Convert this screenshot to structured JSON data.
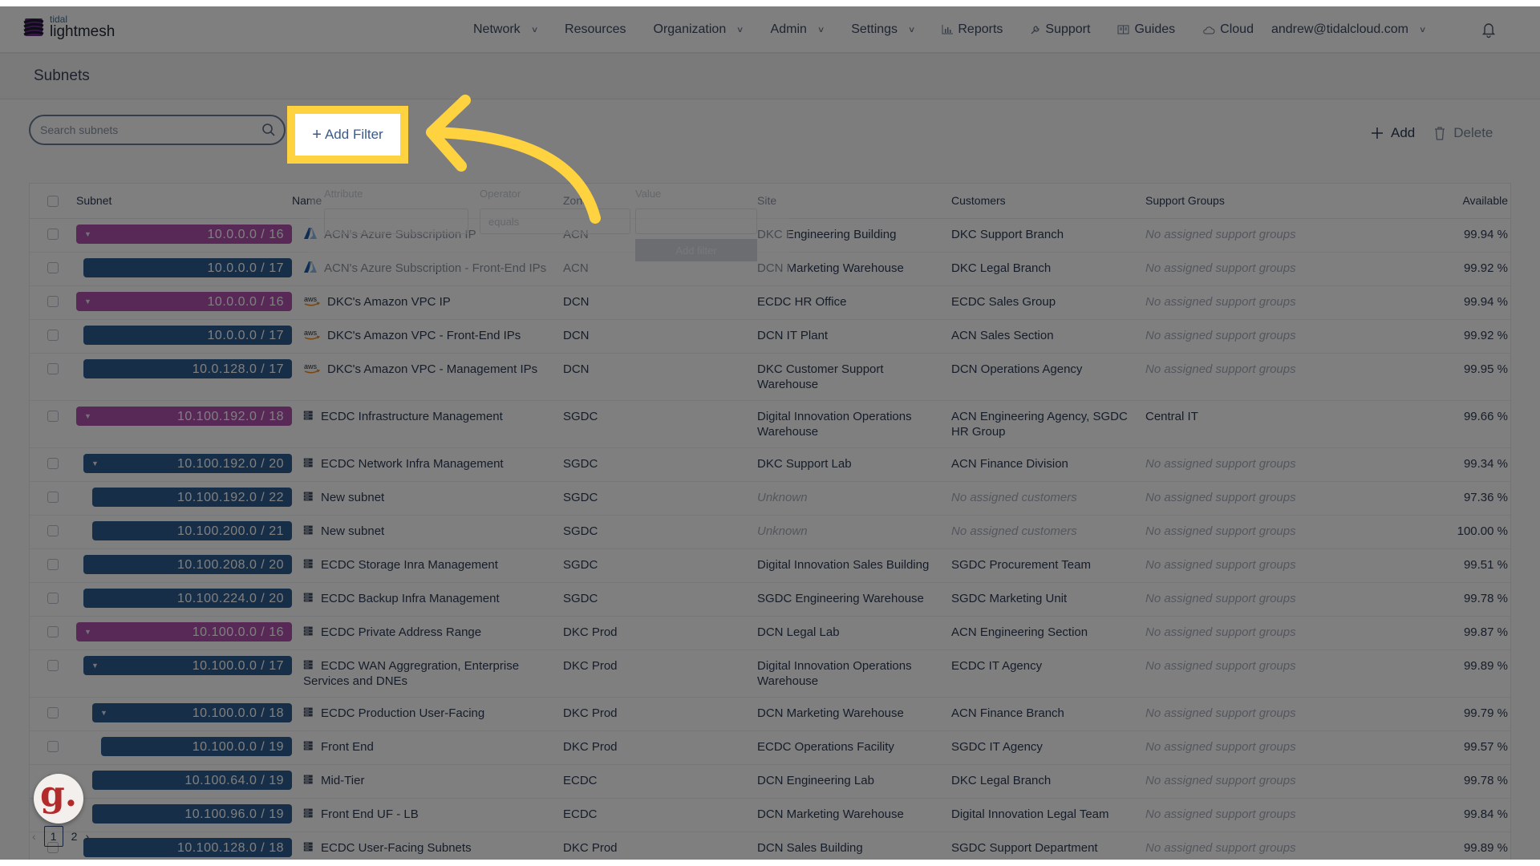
{
  "app": {
    "logo_small": "tidal",
    "logo_big": "lightmesh"
  },
  "nav": {
    "items": [
      {
        "label": "Network",
        "icon": "",
        "dropdown": true
      },
      {
        "label": "Resources",
        "icon": "",
        "dropdown": false
      },
      {
        "label": "Organization",
        "icon": "",
        "dropdown": true
      },
      {
        "label": "Admin",
        "icon": "",
        "dropdown": true
      },
      {
        "label": "Settings",
        "icon": "",
        "dropdown": true
      },
      {
        "label": "Reports",
        "icon": "bar-chart-icon",
        "dropdown": false
      },
      {
        "label": "Support",
        "icon": "wrench-icon",
        "dropdown": false
      },
      {
        "label": "Guides",
        "icon": "book-icon",
        "dropdown": false
      },
      {
        "label": "Cloud",
        "icon": "cloud-icon",
        "dropdown": false
      }
    ],
    "user": "andrew@tidalcloud.com"
  },
  "page": {
    "title": "Subnets"
  },
  "toolbar": {
    "search_placeholder": "Search subnets",
    "search_value": "",
    "add_filter_label": "Add Filter",
    "add_label": "Add",
    "delete_label": "Delete"
  },
  "filter_popover": {
    "attribute_label": "Attribute",
    "operator_label": "Operator",
    "operator_value": "equals",
    "value_label": "Value",
    "submit_label": "Add filter"
  },
  "table": {
    "columns": [
      "Subnet",
      "Name",
      "Zone",
      "Site",
      "Customers",
      "Support Groups",
      "Available"
    ],
    "rows": [
      {
        "subnet": "10.0.0.0 / 16",
        "level": 0,
        "expandable": true,
        "color": "purple",
        "icon": "azure",
        "name": "ACN's Azure Subscription IP",
        "zone": "ACN",
        "site": "DKC Engineering Building",
        "customers": "DKC Support Branch",
        "support_groups": "No assigned support groups",
        "available": "99.94 %"
      },
      {
        "subnet": "10.0.0.0 / 17",
        "level": 1,
        "expandable": false,
        "color": "blue",
        "icon": "azure",
        "name": "ACN's Azure Subscription - Front-End IPs",
        "zone": "ACN",
        "site": "DCN Marketing Warehouse",
        "customers": "DKC Legal Branch",
        "support_groups": "No assigned support groups",
        "available": "99.92 %"
      },
      {
        "subnet": "10.0.0.0 / 16",
        "level": 0,
        "expandable": true,
        "color": "purple",
        "icon": "aws",
        "name": "DKC's Amazon VPC IP",
        "zone": "DCN",
        "site": "ECDC HR Office",
        "customers": "ECDC Sales Group",
        "support_groups": "No assigned support groups",
        "available": "99.94 %"
      },
      {
        "subnet": "10.0.0.0 / 17",
        "level": 1,
        "expandable": false,
        "color": "blue",
        "icon": "aws",
        "name": "DKC's Amazon VPC - Front-End IPs",
        "zone": "DCN",
        "site": "DCN IT Plant",
        "customers": "ACN Sales Section",
        "support_groups": "No assigned support groups",
        "available": "99.92 %"
      },
      {
        "subnet": "10.0.128.0 / 17",
        "level": 1,
        "expandable": false,
        "color": "blue",
        "icon": "aws",
        "name": "DKC's Amazon VPC - Management IPs",
        "zone": "DCN",
        "site": "DKC Customer Support Warehouse",
        "customers": "DCN Operations Agency",
        "support_groups": "No assigned support groups",
        "available": "99.95 %"
      },
      {
        "subnet": "10.100.192.0 / 18",
        "level": 0,
        "expandable": true,
        "color": "purple",
        "icon": "server",
        "name": "ECDC Infrastructure Management",
        "zone": "SGDC",
        "site": "Digital Innovation Operations Warehouse",
        "customers": "ACN Engineering Agency, SGDC HR Group",
        "support_groups": "Central IT",
        "available": "99.66 %"
      },
      {
        "subnet": "10.100.192.0 / 20",
        "level": 1,
        "expandable": true,
        "color": "blue",
        "icon": "server",
        "name": "ECDC Network Infra Management",
        "zone": "SGDC",
        "site": "DKC Support Lab",
        "customers": "ACN Finance Division",
        "support_groups": "No assigned support groups",
        "available": "99.34 %"
      },
      {
        "subnet": "10.100.192.0 / 22",
        "level": 2,
        "expandable": false,
        "color": "blue",
        "icon": "server",
        "name": "New subnet",
        "zone": "SGDC",
        "site": "Unknown",
        "customers": "No assigned customers",
        "support_groups": "No assigned support groups",
        "available": "97.36 %"
      },
      {
        "subnet": "10.100.200.0 / 21",
        "level": 2,
        "expandable": false,
        "color": "blue",
        "icon": "server",
        "name": "New subnet",
        "zone": "SGDC",
        "site": "Unknown",
        "customers": "No assigned customers",
        "support_groups": "No assigned support groups",
        "available": "100.00 %"
      },
      {
        "subnet": "10.100.208.0 / 20",
        "level": 1,
        "expandable": false,
        "color": "blue",
        "icon": "server",
        "name": "ECDC Storage Inra Management",
        "zone": "SGDC",
        "site": "Digital Innovation Sales Building",
        "customers": "SGDC Procurement Team",
        "support_groups": "No assigned support groups",
        "available": "99.51 %"
      },
      {
        "subnet": "10.100.224.0 / 20",
        "level": 1,
        "expandable": false,
        "color": "blue",
        "icon": "server",
        "name": "ECDC Backup Infra Management",
        "zone": "SGDC",
        "site": "SGDC Engineering Warehouse",
        "customers": "SGDC Marketing Unit",
        "support_groups": "No assigned support groups",
        "available": "99.78 %"
      },
      {
        "subnet": "10.100.0.0 / 16",
        "level": 0,
        "expandable": true,
        "color": "purple",
        "icon": "server",
        "name": "ECDC Private Address Range",
        "zone": "DKC Prod",
        "site": "DCN Legal Lab",
        "customers": "ACN Engineering Section",
        "support_groups": "No assigned support groups",
        "available": "99.87 %"
      },
      {
        "subnet": "10.100.0.0 / 17",
        "level": 1,
        "expandable": true,
        "color": "blue",
        "icon": "server",
        "name": "ECDC WAN Aggregration, Enterprise Services and DNEs",
        "zone": "DKC Prod",
        "site": "Digital Innovation Operations Warehouse",
        "customers": "ECDC IT Agency",
        "support_groups": "No assigned support groups",
        "available": "99.89 %"
      },
      {
        "subnet": "10.100.0.0 / 18",
        "level": 2,
        "expandable": true,
        "color": "blue",
        "icon": "server",
        "name": "ECDC Production User-Facing",
        "zone": "DKC Prod",
        "site": "DCN Marketing Warehouse",
        "customers": "ACN Finance Branch",
        "support_groups": "No assigned support groups",
        "available": "99.79 %"
      },
      {
        "subnet": "10.100.0.0 / 19",
        "level": 3,
        "expandable": false,
        "color": "blue",
        "icon": "server",
        "name": "Front End",
        "zone": "DKC Prod",
        "site": "ECDC Operations Facility",
        "customers": "SGDC IT Agency",
        "support_groups": "No assigned support groups",
        "available": "99.57 %"
      },
      {
        "subnet": "10.100.64.0 / 19",
        "level": 2,
        "expandable": false,
        "color": "blue",
        "icon": "server",
        "name": "Mid-Tier",
        "zone": "ECDC",
        "site": "DCN Engineering Lab",
        "customers": "DKC Legal Branch",
        "support_groups": "No assigned support groups",
        "available": "99.78 %"
      },
      {
        "subnet": "10.100.96.0 / 19",
        "level": 2,
        "expandable": false,
        "color": "blue",
        "icon": "server",
        "name": "Front End UF - LB",
        "zone": "ECDC",
        "site": "DCN Marketing Warehouse",
        "customers": "Digital Innovation Legal Team",
        "support_groups": "No assigned support groups",
        "available": "99.84 %"
      },
      {
        "subnet": "10.100.128.0 / 18",
        "level": 1,
        "expandable": false,
        "color": "blue",
        "icon": "server",
        "name": "ECDC User-Facing Subnets",
        "zone": "DKC Prod",
        "site": "DCN Sales Building",
        "customers": "SGDC Support Department",
        "support_groups": "No assigned support groups",
        "available": "99.89 %"
      }
    ]
  },
  "pagination": {
    "current": "1",
    "pages": [
      "1",
      "2"
    ]
  },
  "muted_values": [
    "Unknown",
    "No assigned customers",
    "No assigned support groups"
  ],
  "colors": {
    "purple_badge": "#b052ae",
    "blue_badge": "#2c5c8f",
    "highlight": "#ffd23f",
    "brand_purple": "#6a2a8a"
  },
  "watermark": {
    "label": "g."
  }
}
